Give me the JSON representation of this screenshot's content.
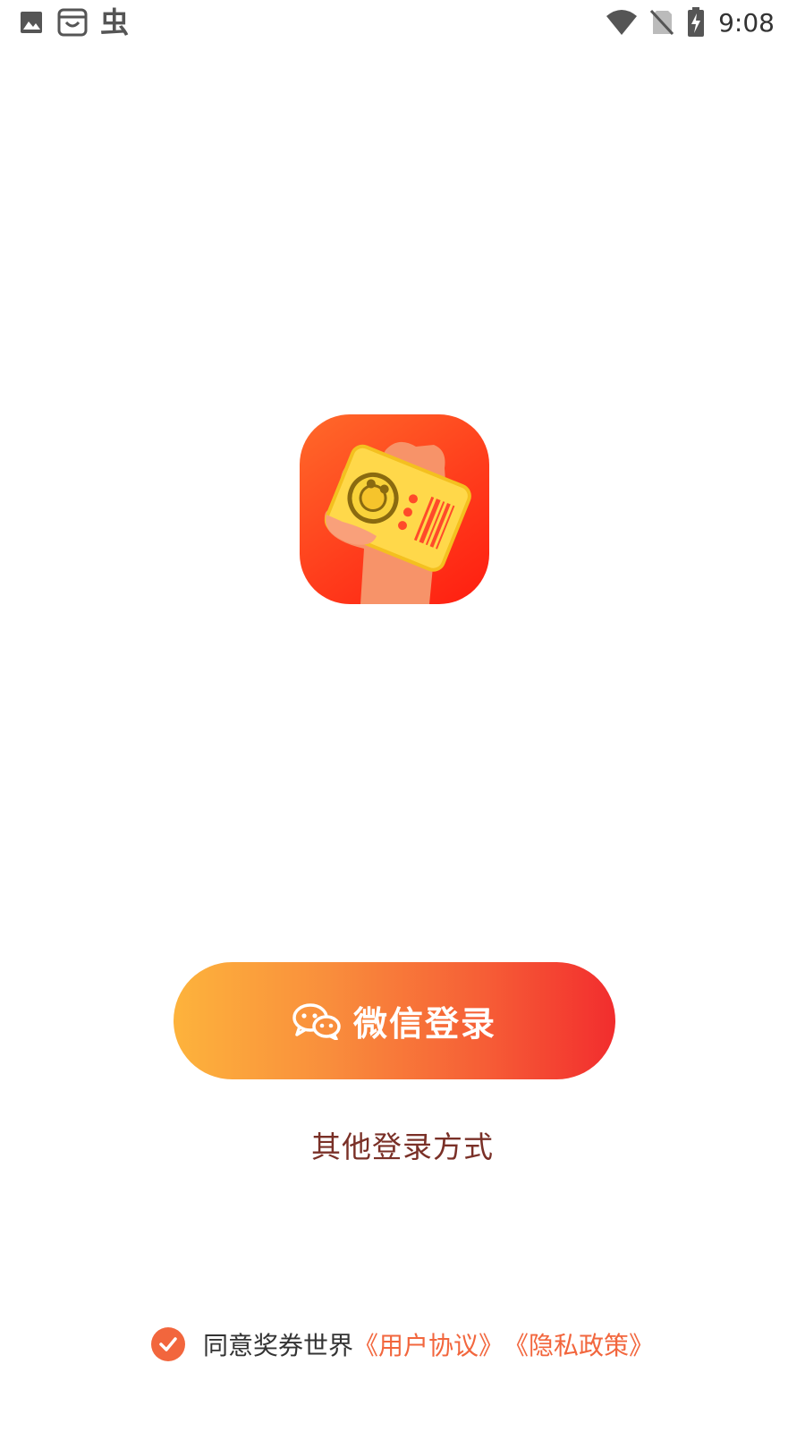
{
  "status_bar": {
    "left_icons": [
      "image-icon",
      "shopping-bag-icon",
      "bug-app-icon"
    ],
    "right_icons": [
      "wifi-icon",
      "no-sim-icon",
      "battery-charging-icon"
    ],
    "time": "9:08",
    "app_glyph": "虫"
  },
  "logo": {
    "icon": "hand-holding-ticket-logo"
  },
  "login": {
    "wechat_label": "微信登录",
    "wechat_icon": "wechat-icon",
    "other_label": "其他登录方式"
  },
  "agreement": {
    "checked": true,
    "prefix": "同意奖券世界",
    "user_agreement": "《用户协议》",
    "privacy_policy": "《隐私政策》"
  },
  "colors": {
    "accent": "#f2663d",
    "button_start": "#fdb33c",
    "button_end": "#f22d2e",
    "secondary_text": "#7a3027"
  }
}
